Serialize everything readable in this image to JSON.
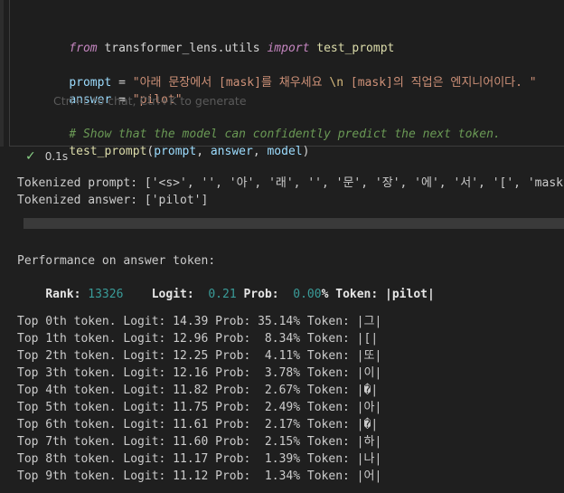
{
  "code": {
    "line1": {
      "from": "from",
      "module": " transformer_lens.utils ",
      "import": "import",
      "name": " test_prompt"
    },
    "line2": {
      "var": "prompt",
      "eq": " = ",
      "str_a": "\"아래 문장에서 [mask]를 채우세요 ",
      "esc": "\\n",
      "str_b": " [mask]의 직업은 엔지니어이다. \""
    },
    "line3": {
      "var": "answer",
      "eq": " = ",
      "str": "\"pilot\""
    },
    "ghost_hint": "Ctrl+L to chat, Ctrl+K to generate",
    "line4_comment": "# Show that the model can confidently predict the next token.",
    "line5": {
      "fn": "test_prompt",
      "open": "(",
      "a1": "prompt",
      "sep1": ", ",
      "a2": "answer",
      "sep2": ", ",
      "a3": "model",
      "close": ")"
    }
  },
  "execution": {
    "status_icon": "check-icon",
    "time": "0.1s"
  },
  "output": {
    "tokenized_prompt": "Tokenized prompt: ['<s>', '', '아', '래', '', '문', '장', '에', '서', '[', 'mask",
    "tokenized_answer": "Tokenized answer: ['pilot']",
    "perf_header": "Performance on answer token:",
    "rank_label": "Rank: ",
    "rank_value": "13326",
    "logit_label": "    Logit:  ",
    "logit_value": "0.21",
    "prob_label": " Prob:  ",
    "prob_value": "0.00",
    "token_label": "% Token: |pilot|",
    "top_rows": [
      "Top 0th token. Logit: 14.39 Prob: 35.14% Token: |그|",
      "Top 1th token. Logit: 12.96 Prob:  8.34% Token: |[|",
      "Top 2th token. Logit: 12.25 Prob:  4.11% Token: |또|",
      "Top 3th token. Logit: 12.16 Prob:  3.78% Token: |이|",
      "Top 4th token. Logit: 11.82 Prob:  2.67% Token: |�|",
      "Top 5th token. Logit: 11.75 Prob:  2.49% Token: |아|",
      "Top 6th token. Logit: 11.61 Prob:  2.17% Token: |�|",
      "Top 7th token. Logit: 11.60 Prob:  2.15% Token: |하|",
      "Top 8th token. Logit: 11.17 Prob:  1.39% Token: |나|",
      "Top 9th token. Logit: 11.12 Prob:  1.34% Token: |어|"
    ]
  }
}
